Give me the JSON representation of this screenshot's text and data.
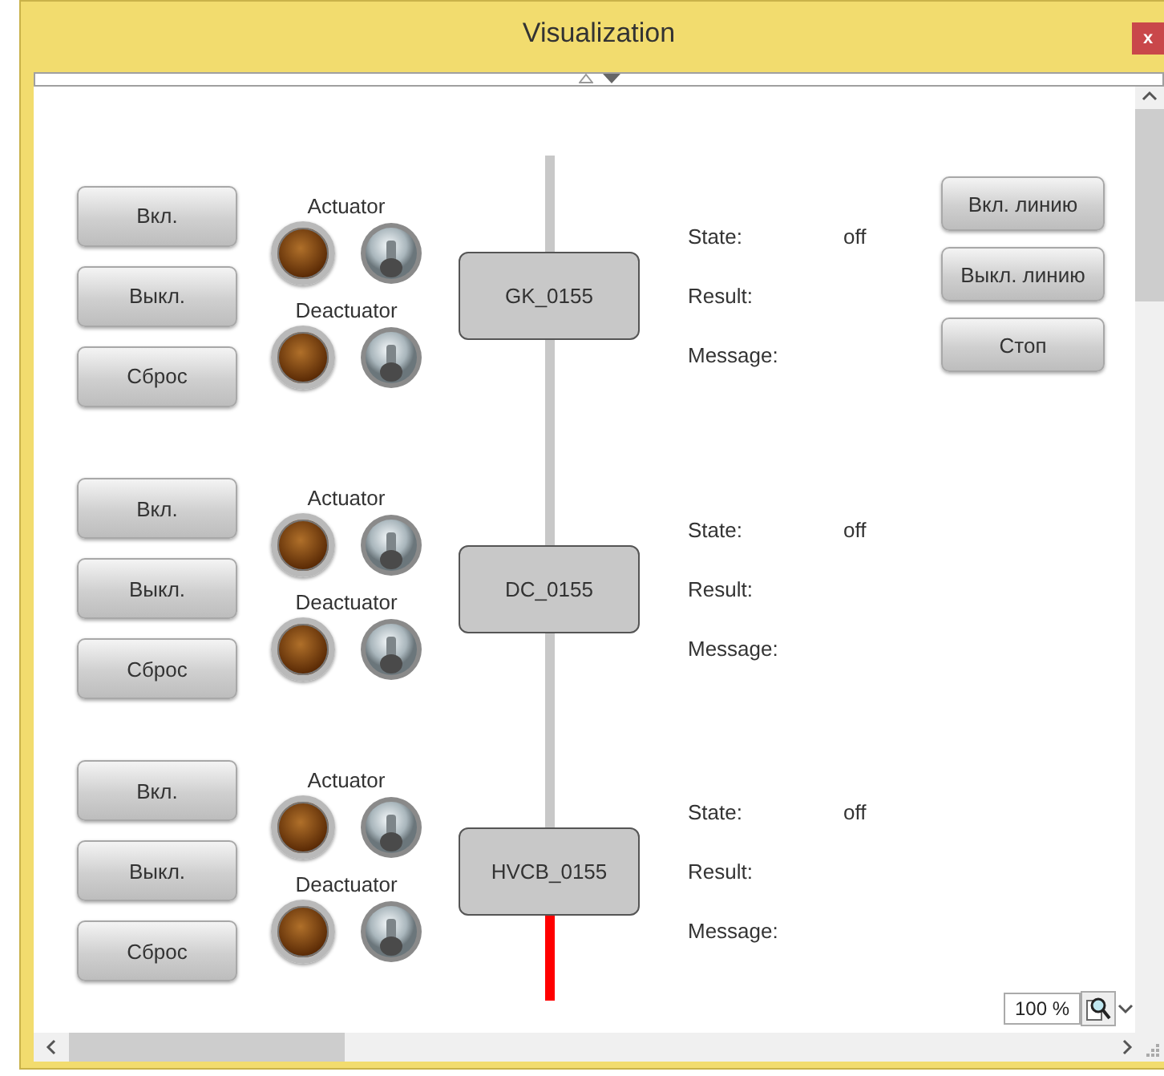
{
  "window": {
    "title": "Visualization",
    "close": "x"
  },
  "devices": [
    {
      "name": "GK_0155",
      "buttons": [
        "Вкл.",
        "Выкл.",
        "Сброс"
      ],
      "actuator": {
        "label": "Actuator",
        "lamp_on": false
      },
      "deactuator": {
        "label": "Deactuator",
        "lamp_on": false
      },
      "wire_above": {
        "color": "#c8c8c8"
      },
      "wire_below": {
        "color": "#c8c8c8"
      },
      "info": [
        {
          "label": "State:",
          "value": "off"
        },
        {
          "label": "Result:"
        },
        {
          "label": "Message:"
        }
      ]
    },
    {
      "name": "DC_0155",
      "buttons": [
        "Вкл.",
        "Выкл.",
        "Сброс"
      ],
      "actuator": {
        "label": "Actuator",
        "lamp_on": false
      },
      "deactuator": {
        "label": "Deactuator",
        "lamp_on": false
      },
      "wire_above": {
        "color": "#c8c8c8"
      },
      "wire_below": {
        "color": "#c8c8c8"
      },
      "info": [
        {
          "label": "State:",
          "value": "off"
        },
        {
          "label": "Result:"
        },
        {
          "label": "Message:"
        }
      ]
    },
    {
      "name": "HVCB_0155",
      "buttons": [
        "Вкл.",
        "Выкл.",
        "Сброс"
      ],
      "actuator": {
        "label": "Actuator",
        "lamp_on": false
      },
      "deactuator": {
        "label": "Deactuator",
        "lamp_on": false
      },
      "wire_above": {
        "color": "#c8c8c8"
      },
      "wire_below": {
        "color": "#ff0000"
      },
      "info": [
        {
          "label": "State:",
          "value": "off"
        },
        {
          "label": "Result:"
        },
        {
          "label": "Message:"
        }
      ]
    }
  ],
  "line_buttons": [
    "Вкл. линию",
    "Выкл. линию",
    "Стоп"
  ],
  "zoom": {
    "value": "100 %"
  }
}
